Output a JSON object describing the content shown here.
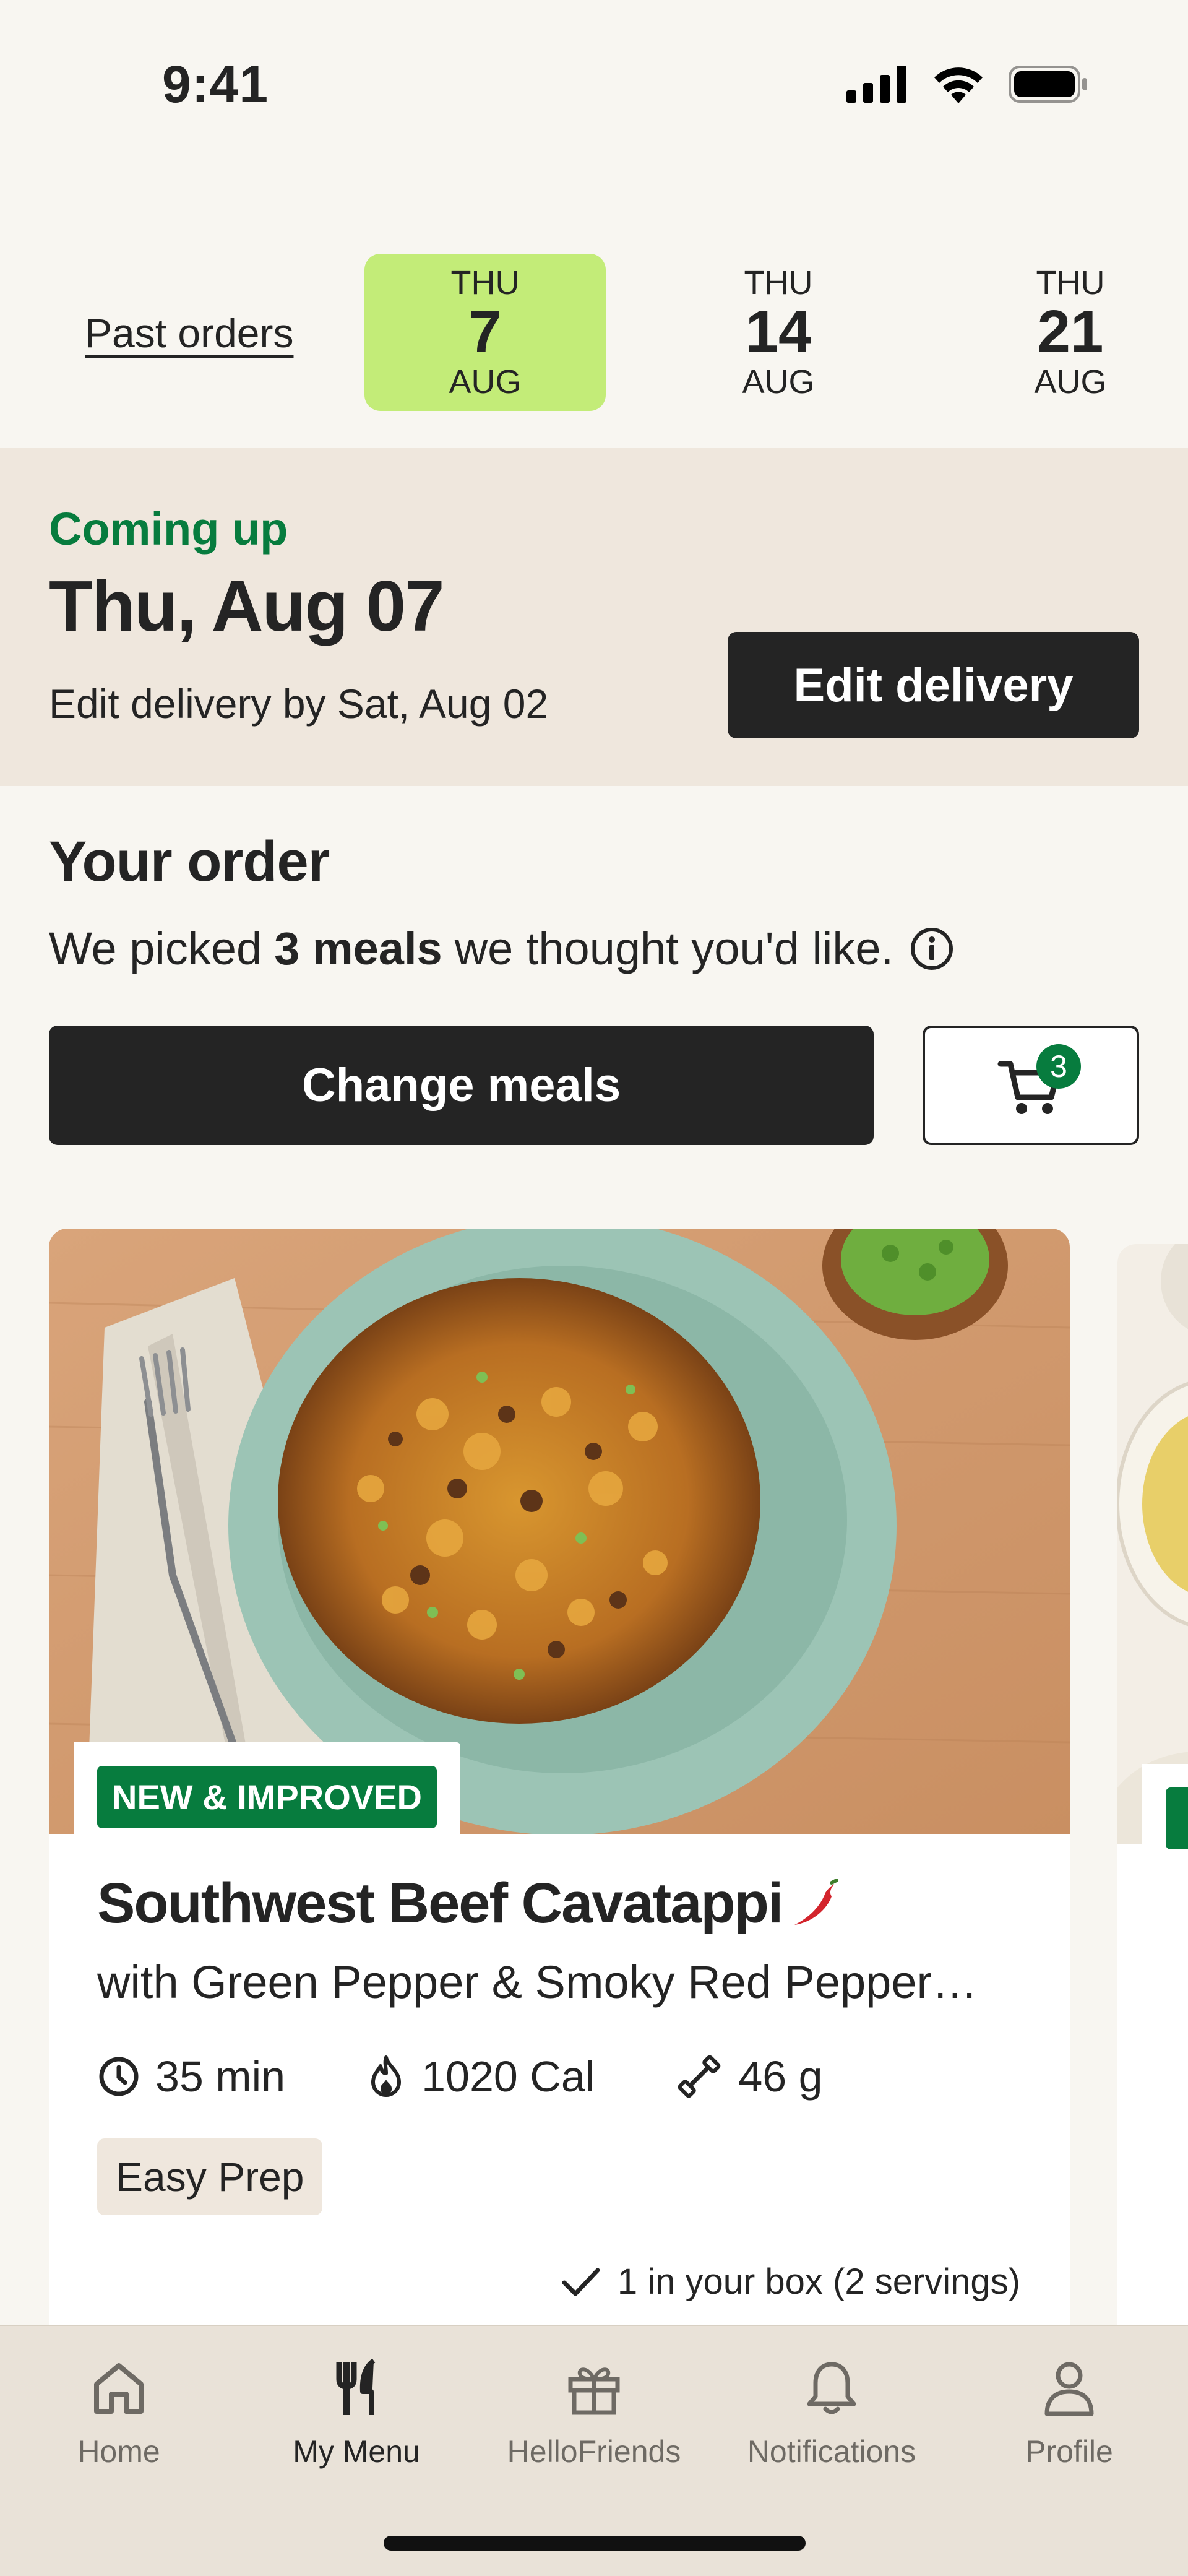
{
  "status_bar": {
    "time": "9:41"
  },
  "date_selector": {
    "past_orders_label": "Past orders",
    "dates": [
      {
        "dow": "THU",
        "day": "7",
        "month": "AUG",
        "selected": true
      },
      {
        "dow": "THU",
        "day": "14",
        "month": "AUG",
        "selected": false
      },
      {
        "dow": "THU",
        "day": "21",
        "month": "AUG",
        "selected": false
      }
    ]
  },
  "coming_up": {
    "label": "Coming up",
    "date": "Thu, Aug 07",
    "edit_by": "Edit delivery by Sat, Aug 02",
    "edit_button": "Edit delivery"
  },
  "order": {
    "heading": "Your order",
    "desc_prefix": "We picked",
    "desc_bold": "3 meals",
    "desc_suffix": "we thought you'd like.",
    "change_button": "Change meals",
    "cart_count": "3"
  },
  "meals": [
    {
      "tag": "NEW & IMPROVED",
      "title": "Southwest Beef Cavatappi",
      "subtitle": "with Green Pepper & Smoky Red Pepper…",
      "time": "35 min",
      "calories": "1020 Cal",
      "protein": "46 g",
      "prep_tag": "Easy Prep",
      "in_box": "1 in your box (2 servings)",
      "spicy": true
    }
  ],
  "tab_bar": {
    "items": [
      {
        "label": "Home",
        "icon": "home-icon",
        "active": false
      },
      {
        "label": "My Menu",
        "icon": "fork-knife-icon",
        "active": true
      },
      {
        "label": "HelloFriends",
        "icon": "gift-icon",
        "active": false
      },
      {
        "label": "Notifications",
        "icon": "bell-icon",
        "active": false
      },
      {
        "label": "Profile",
        "icon": "person-icon",
        "active": false
      }
    ]
  },
  "colors": {
    "accent_green": "#077c3e",
    "selected_date_bg": "#c3ec78",
    "banner_bg": "#efe7dd",
    "button_dark": "#242424"
  }
}
